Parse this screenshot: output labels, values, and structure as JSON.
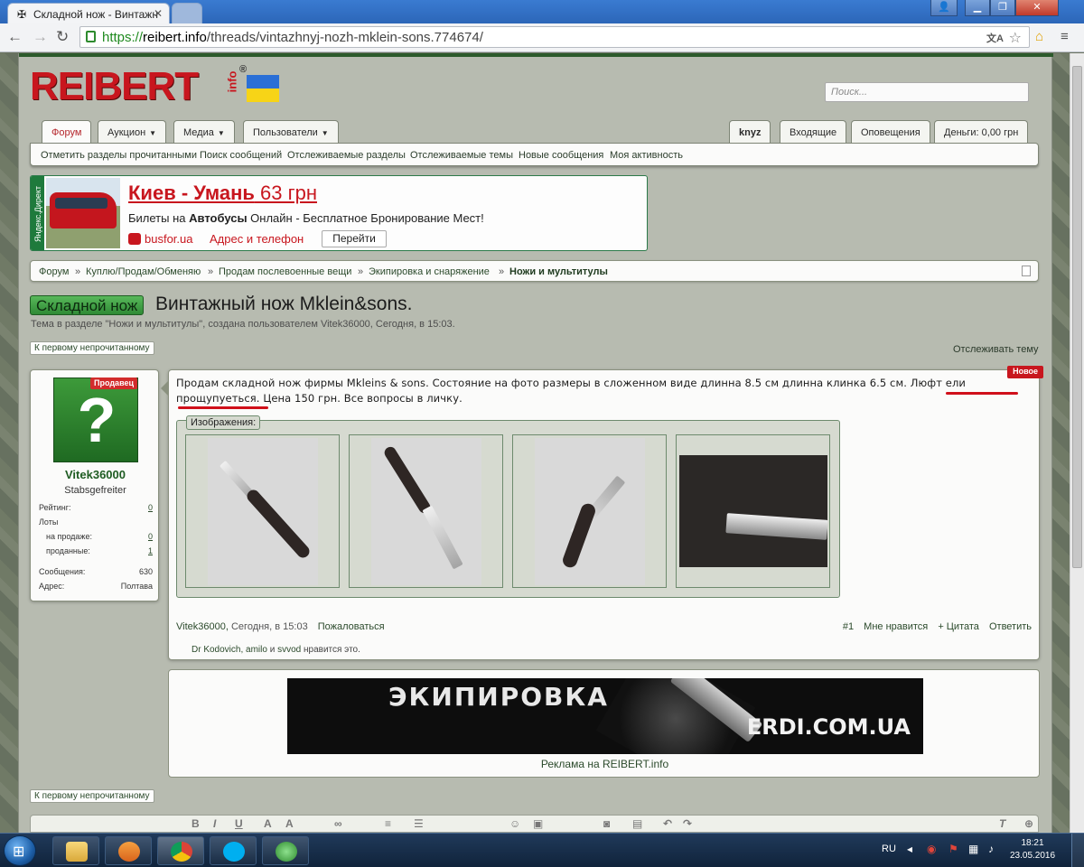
{
  "browser": {
    "tab_title": "Складной нож - Винтажн",
    "tab_favicon": "✠",
    "url_scheme": "https://",
    "url_host": "reibert.info",
    "url_path": "/threads/vintazhnyj-nozh-mklein-sons.774674/"
  },
  "header": {
    "logo": "REIBERT",
    "logo_sub": "info",
    "logo_reg": "®",
    "search_placeholder": "Поиск..."
  },
  "nav": {
    "tabs": [
      {
        "label": "Форум"
      },
      {
        "label": "Аукцион"
      },
      {
        "label": "Медиа"
      },
      {
        "label": "Пользователи"
      }
    ],
    "user_tabs": [
      {
        "label": "knyz"
      },
      {
        "label": "Входящие"
      },
      {
        "label": "Оповещения"
      },
      {
        "label": "Деньги: 0,00 грн"
      }
    ],
    "sub": [
      {
        "label": "Отметить разделы прочитанными"
      },
      {
        "label": "Поиск сообщений"
      },
      {
        "label": "Отслеживаемые разделы"
      },
      {
        "label": "Отслеживаемые темы"
      },
      {
        "label": "Новые сообщения"
      },
      {
        "label": "Моя активность"
      }
    ]
  },
  "ad": {
    "tag": "Яндекс.Директ",
    "title_bold": "Киев - Умань",
    "title_rest": " 63 грн",
    "desc_a": "Билеты на ",
    "desc_b": "Автобусы",
    "desc_c": " Онлайн - Бесплатное Бронирование Мест!",
    "host": "busfor.ua",
    "contact": "Адрес и телефон",
    "go": "Перейти"
  },
  "breadcrumbs": [
    {
      "label": "Форум"
    },
    {
      "label": "Куплю/Продам/Обменяю"
    },
    {
      "label": "Продам послевоенные вещи"
    },
    {
      "label": "Экипировка и снаряжение"
    },
    {
      "label": "Ножи и мультитулы"
    }
  ],
  "breadcrumb_sep": "»",
  "thread": {
    "prefix": "Складной нож",
    "title": "Винтажный нож Mklein&sons.",
    "desc": "Тема в разделе \"Ножи и мультитулы\", создана пользователем Vitek36000, Сегодня, в 15:03.",
    "first_unread": "К первому непрочитанному",
    "watch": "Отслеживать тему"
  },
  "user": {
    "badge": "Продавец",
    "avatar_glyph": "?",
    "name": "Vitek36000",
    "rank": "Stabsgefreiter",
    "stats": [
      {
        "label": "Рейтинг:",
        "value": "0"
      },
      {
        "label": "Лоты",
        "value": ""
      },
      {
        "label": "на продаже:",
        "value": "0"
      },
      {
        "label": "проданные:",
        "value": "1"
      },
      {
        "label": "Сообщения:",
        "value": "630"
      },
      {
        "label": "Адрес:",
        "value": "Полтава"
      }
    ]
  },
  "post": {
    "new_tag": "Новое",
    "line1": "Продам складной нож фирмы Mkleins & sons. Состояние на фото размеры в сложенном виде длинна 8.5 см длинна клинка 6.5 см. Люфт ели",
    "line2": "прощупуеться. Цена 150 грн. Все вопросы в личку.",
    "attachments_label": "Изображения:",
    "author": "Vitek36000",
    "date": "Сегодня, в 15:03",
    "report": "Пожаловаться",
    "number": "#1",
    "like": "Мне нравится",
    "quote": "+ Цитата",
    "reply": "Ответить",
    "likes_users": "Dr Kodovich, amilo",
    "likes_and": " и ",
    "likes_last": "svvod",
    "likes_tail": " нравится это."
  },
  "banner": {
    "line1": "ЭКИПИРОВКА",
    "line2": "ERDI.COM.UA",
    "caption": "Реклама на REIBERT.info"
  },
  "taskbar": {
    "lang": "RU",
    "time": "18:21",
    "date": "23.05.2016"
  },
  "colors": {
    "brand_red": "#c8161e",
    "forum_green": "#1e5c22"
  }
}
